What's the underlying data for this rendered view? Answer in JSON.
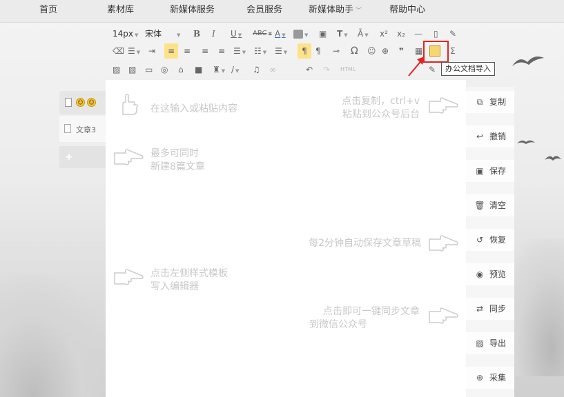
{
  "nav": {
    "items": [
      "首页",
      "素材库",
      "新媒体服务",
      "会员服务",
      "新媒体助手",
      "帮助中心"
    ],
    "dropdown_index": 4
  },
  "sidebar": {
    "article_label": "文章3"
  },
  "toolbar": {
    "font_size": "14px",
    "font_family": "宋体",
    "html_label": "HTML",
    "tooltip": "办公文档导入"
  },
  "editor": {
    "hints": [
      "在这输入或粘贴内容",
      "点击复制，ctrl+v",
      "粘贴到公众号后台",
      "最多可同时",
      "新建8篇文章",
      "每2分钟自动保存文章草稿",
      "点击左侧样式模板",
      "写入编辑器",
      "点击即可一键同步文章",
      "到微信公众号"
    ]
  },
  "actions": [
    {
      "label": "复制",
      "icon": "copy-icon"
    },
    {
      "label": "撤销",
      "icon": "undo-icon"
    },
    {
      "label": "保存",
      "icon": "save-icon"
    },
    {
      "label": "清空",
      "icon": "trash-icon"
    },
    {
      "label": "恢复",
      "icon": "restore-icon"
    },
    {
      "label": "预览",
      "icon": "eye-icon"
    },
    {
      "label": "同步",
      "icon": "sync-icon"
    },
    {
      "label": "导出",
      "icon": "export-icon"
    },
    {
      "label": "采集",
      "icon": "collect-icon"
    }
  ],
  "colors": {
    "highlight_box": "#e32323",
    "active_button": "#fde28a",
    "hint_text": "#c8c8c8"
  }
}
